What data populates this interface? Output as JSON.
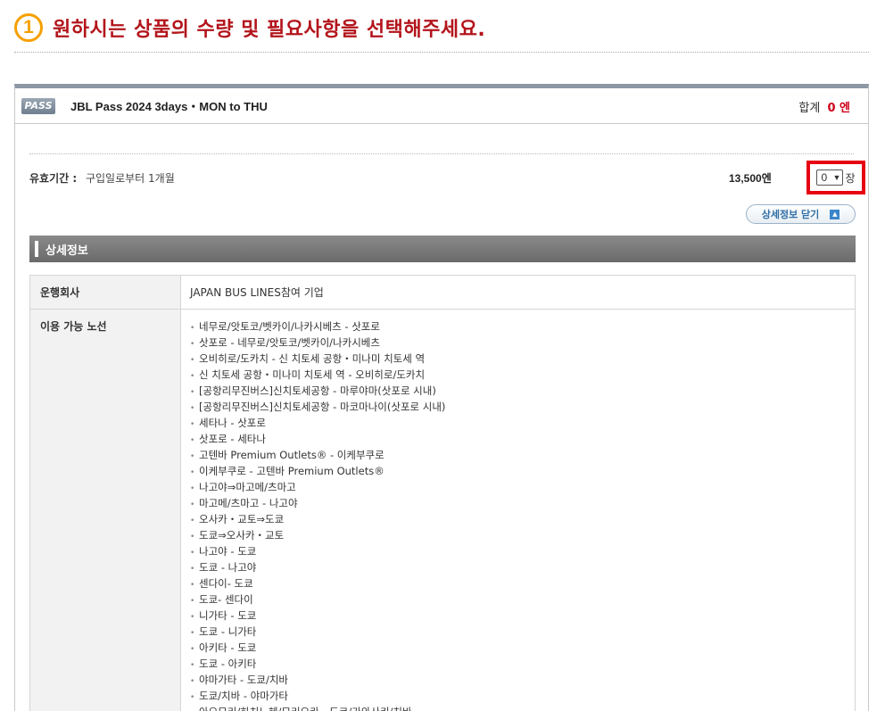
{
  "step": {
    "number": "1",
    "title": "원하시는 상품의 수량 및 필요사항을 선택해주세요."
  },
  "product": {
    "badge": "PASS",
    "name": "JBL Pass 2024 3days・MON to THU",
    "total_label": "합계",
    "total_value": "0 엔",
    "validity_label": "유효기간 :",
    "validity_value": "구입일로부터 1개월",
    "price": "13,500엔",
    "quantity": "0",
    "quantity_unit": "장",
    "detail_toggle_label": "상세정보 닫기"
  },
  "details": {
    "section_title": "상세정보",
    "operator_label": "운행회사",
    "operator_value": "JAPAN BUS LINES참여 기업",
    "routes_label": "이용 가능 노선",
    "routes": [
      "네무로/앗토코/벳카이/나카시베츠 - 삿포로",
      "삿포로 - 네무로/앗토코/벳카이/나카시베츠",
      "오비히로/도카치 - 신 치토세 공항・미나미 치토세 역",
      "신 치토세 공항・미나미 치토세 역 - 오비히로/도카치",
      "[공항리무진버스]신치토세공항 - 마루야마(삿포로 시내)",
      "[공항리무진버스]신치토세공항 - 마코마나이(삿포로 시내)",
      "세타나 - 삿포로",
      "삿포로 - 세타나",
      "고텐바 Premium Outlets® - 이케부쿠로",
      "이케부쿠로 - 고텐바 Premium Outlets®",
      "나고야⇒마고메/츠마고",
      "마고메/츠마고 - 나고야",
      "오사카・교토⇒도쿄",
      "도쿄⇒오사카・교토",
      "나고야 - 도쿄",
      "도쿄 - 나고야",
      "센다이- 도쿄",
      "도쿄- 센다이",
      "니가타 - 도쿄",
      "도쿄 - 니가타",
      "아키타 - 도쿄",
      "도쿄 - 아키타",
      "야마가타 - 도쿄/치바",
      "도쿄/치바 - 야마가타",
      "아오모리/하치노헤/모리오카 - 도쿄/가와사키/치바"
    ]
  }
}
